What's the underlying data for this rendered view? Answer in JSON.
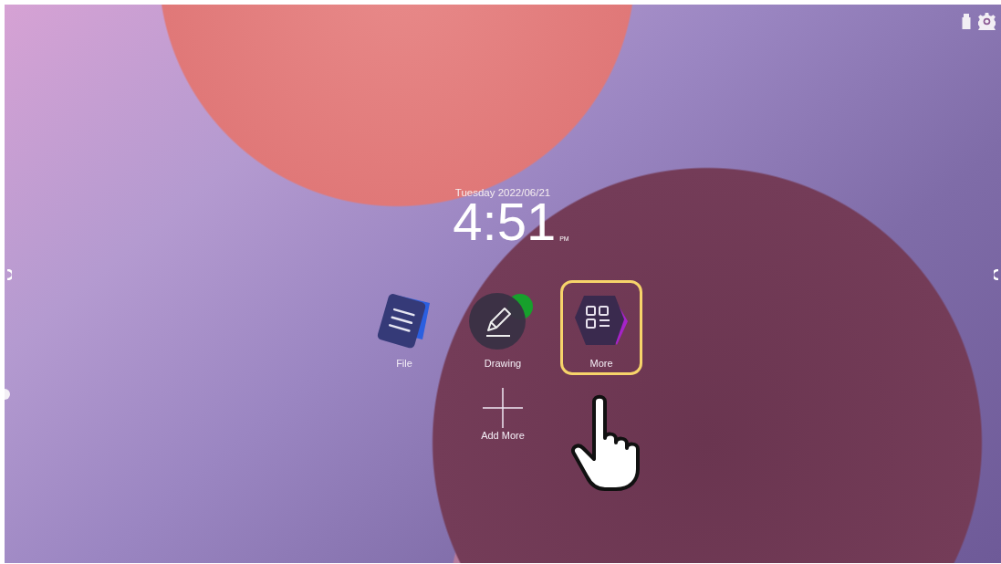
{
  "status_icons": [
    {
      "kind": "usb"
    },
    {
      "kind": "settings"
    }
  ],
  "clock": {
    "date": "Tuesday  2022/06/21",
    "time": "4:51",
    "period": "PM"
  },
  "apps": [
    {
      "label": "File",
      "kind": "file",
      "selected": false
    },
    {
      "label": "Drawing",
      "kind": "drawing",
      "selected": false
    },
    {
      "label": "More",
      "kind": "more",
      "selected": true
    }
  ],
  "add_more": {
    "label": "Add More"
  }
}
